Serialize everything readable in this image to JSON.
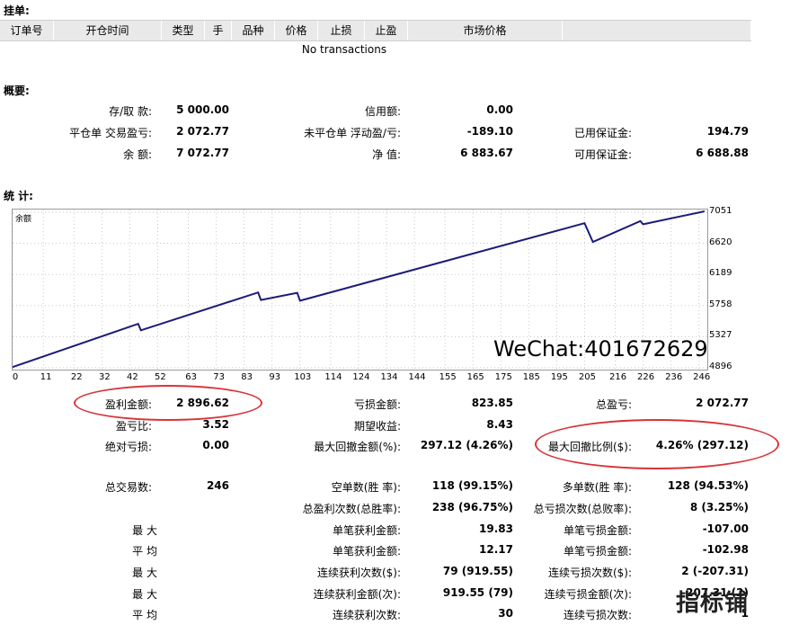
{
  "orders": {
    "title": "挂单:",
    "columns": [
      "订单号",
      "开仓时间",
      "类型",
      "手",
      "品种",
      "价格",
      "止损",
      "止盈",
      "市场价格",
      ""
    ],
    "empty_text": "No transactions"
  },
  "summary": {
    "title": "概要:",
    "deposit_label": "存/取 款:",
    "deposit_value": "5 000.00",
    "credit_label": "信用额:",
    "credit_value": "0.00",
    "closed_pl_label": "平仓单 交易盈亏:",
    "closed_pl_value": "2 072.77",
    "floating_pl_label": "未平仓单 浮动盈/亏:",
    "floating_pl_value": "-189.10",
    "margin_label": "已用保证金:",
    "margin_value": "194.79",
    "balance_label": "余 额:",
    "balance_value": "7 072.77",
    "equity_label": "净 值:",
    "equity_value": "6 883.67",
    "free_margin_label": "可用保证金:",
    "free_margin_value": "6 688.88"
  },
  "stats": {
    "title": "统 计:",
    "gross_profit_label": "盈利金额:",
    "gross_profit_value": "2 896.62",
    "gross_loss_label": "亏损金额:",
    "gross_loss_value": "823.85",
    "total_net_label": "总盈亏:",
    "total_net_value": "2 072.77",
    "profit_factor_label": "盈亏比:",
    "profit_factor_value": "3.52",
    "expected_payoff_label": "期望收益:",
    "expected_payoff_value": "8.43",
    "abs_drawdown_label": "绝对亏损:",
    "abs_drawdown_value": "0.00",
    "max_drawdown_label": "最大回撤金额(%):",
    "max_drawdown_value": "297.12 (4.26%)",
    "rel_drawdown_label": "最大回撤比例($):",
    "rel_drawdown_value": "4.26% (297.12)",
    "total_trades_label": "总交易数:",
    "total_trades_value": "246",
    "short_label": "空单数(胜 率):",
    "short_value": "118 (99.15%)",
    "long_label": "多单数(胜 率):",
    "long_value": "128 (94.53%)",
    "profit_trades_label": "总盈利次数(总胜率):",
    "profit_trades_value": "238 (96.75%)",
    "loss_trades_label": "总亏损次数(总败率):",
    "loss_trades_value": "8 (3.25%)",
    "largest_label": "最 大",
    "largest_profit_label": "单笔获利金额:",
    "largest_profit_value": "19.83",
    "largest_loss_label": "单笔亏损金额:",
    "largest_loss_value": "-107.00",
    "average_label": "平 均",
    "avg_profit_label": "单笔获利金额:",
    "avg_profit_value": "12.17",
    "avg_loss_label": "单笔亏损金额:",
    "avg_loss_value": "-102.98",
    "max_label": "最 大",
    "cons_wins_label": "连续获利次数($):",
    "cons_wins_value": "79 (919.55)",
    "cons_losses_label": "连续亏损次数($):",
    "cons_losses_value": "2 (-207.31)",
    "max2_label": "最 大",
    "cons_profit_label": "连续获利金额(次):",
    "cons_profit_value": "919.55 (79)",
    "cons_loss_label": "连续亏损金额(次):",
    "cons_loss_value": "-207.31 (2)",
    "avg2_label": "平 均",
    "avg_cons_wins_label": "连续获利次数:",
    "avg_cons_wins_value": "30",
    "avg_cons_losses_label": "连续亏损次数:",
    "avg_cons_losses_value": "1"
  },
  "chart_data": {
    "type": "line",
    "title": "余额",
    "xlabel": "",
    "ylabel": "",
    "x_ticks": [
      0,
      11,
      22,
      32,
      42,
      52,
      63,
      73,
      83,
      93,
      103,
      114,
      124,
      134,
      144,
      155,
      165,
      175,
      185,
      195,
      205,
      216,
      226,
      236,
      246
    ],
    "y_ticks": [
      4896,
      5327,
      5758,
      6189,
      6620,
      7051
    ],
    "xlim": [
      0,
      249
    ],
    "ylim": [
      4870,
      7090
    ],
    "line_color": "#1b1b7a",
    "series": [
      {
        "name": "",
        "x": [
          0,
          45,
          46,
          88,
          89,
          102,
          103,
          205,
          208,
          225,
          226,
          248
        ],
        "y": [
          4905,
          5505,
          5415,
          5940,
          5835,
          5935,
          5825,
          6900,
          6640,
          6930,
          6885,
          7065
        ]
      }
    ]
  },
  "watermark": "WeChat:401672629",
  "stamp": "指标铺",
  "accent": "#d8333a"
}
